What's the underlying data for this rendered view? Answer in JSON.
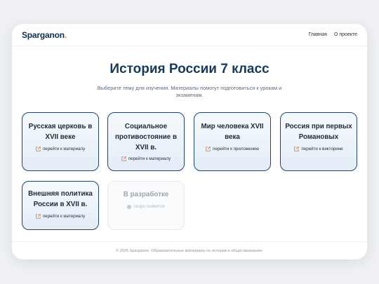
{
  "header": {
    "logo_text": "Sparganon",
    "logo_dot": ".",
    "nav": [
      "Главная",
      "О проекте"
    ]
  },
  "main": {
    "title": "История России 7 класс",
    "subtitle": "Выберите тему для изучения. Материалы помогут подготовиться к урокам и экзаменам."
  },
  "cards": [
    {
      "title": "Русская церковь в XVII веке",
      "link": "перейти к материалу"
    },
    {
      "title": "Социальное противостояние в XVII в.",
      "link": "перейти к материалу"
    },
    {
      "title": "Мир человека XVII века",
      "link": "перейти к приложению"
    },
    {
      "title": "Россия при первых Романовых",
      "link": "перейти к викторине"
    },
    {
      "title": "Внешняя политика России в XVII в.",
      "link": "перейти к материалу"
    },
    {
      "title": "В разработке",
      "link": "скоро появится"
    }
  ],
  "footer": {
    "text": "© 2025 Sparganon. Образовательные материалы по истории и обществознанию."
  },
  "colors": {
    "accent": "#e8804f",
    "card_border": "#1f4470",
    "title": "#163a5a"
  }
}
